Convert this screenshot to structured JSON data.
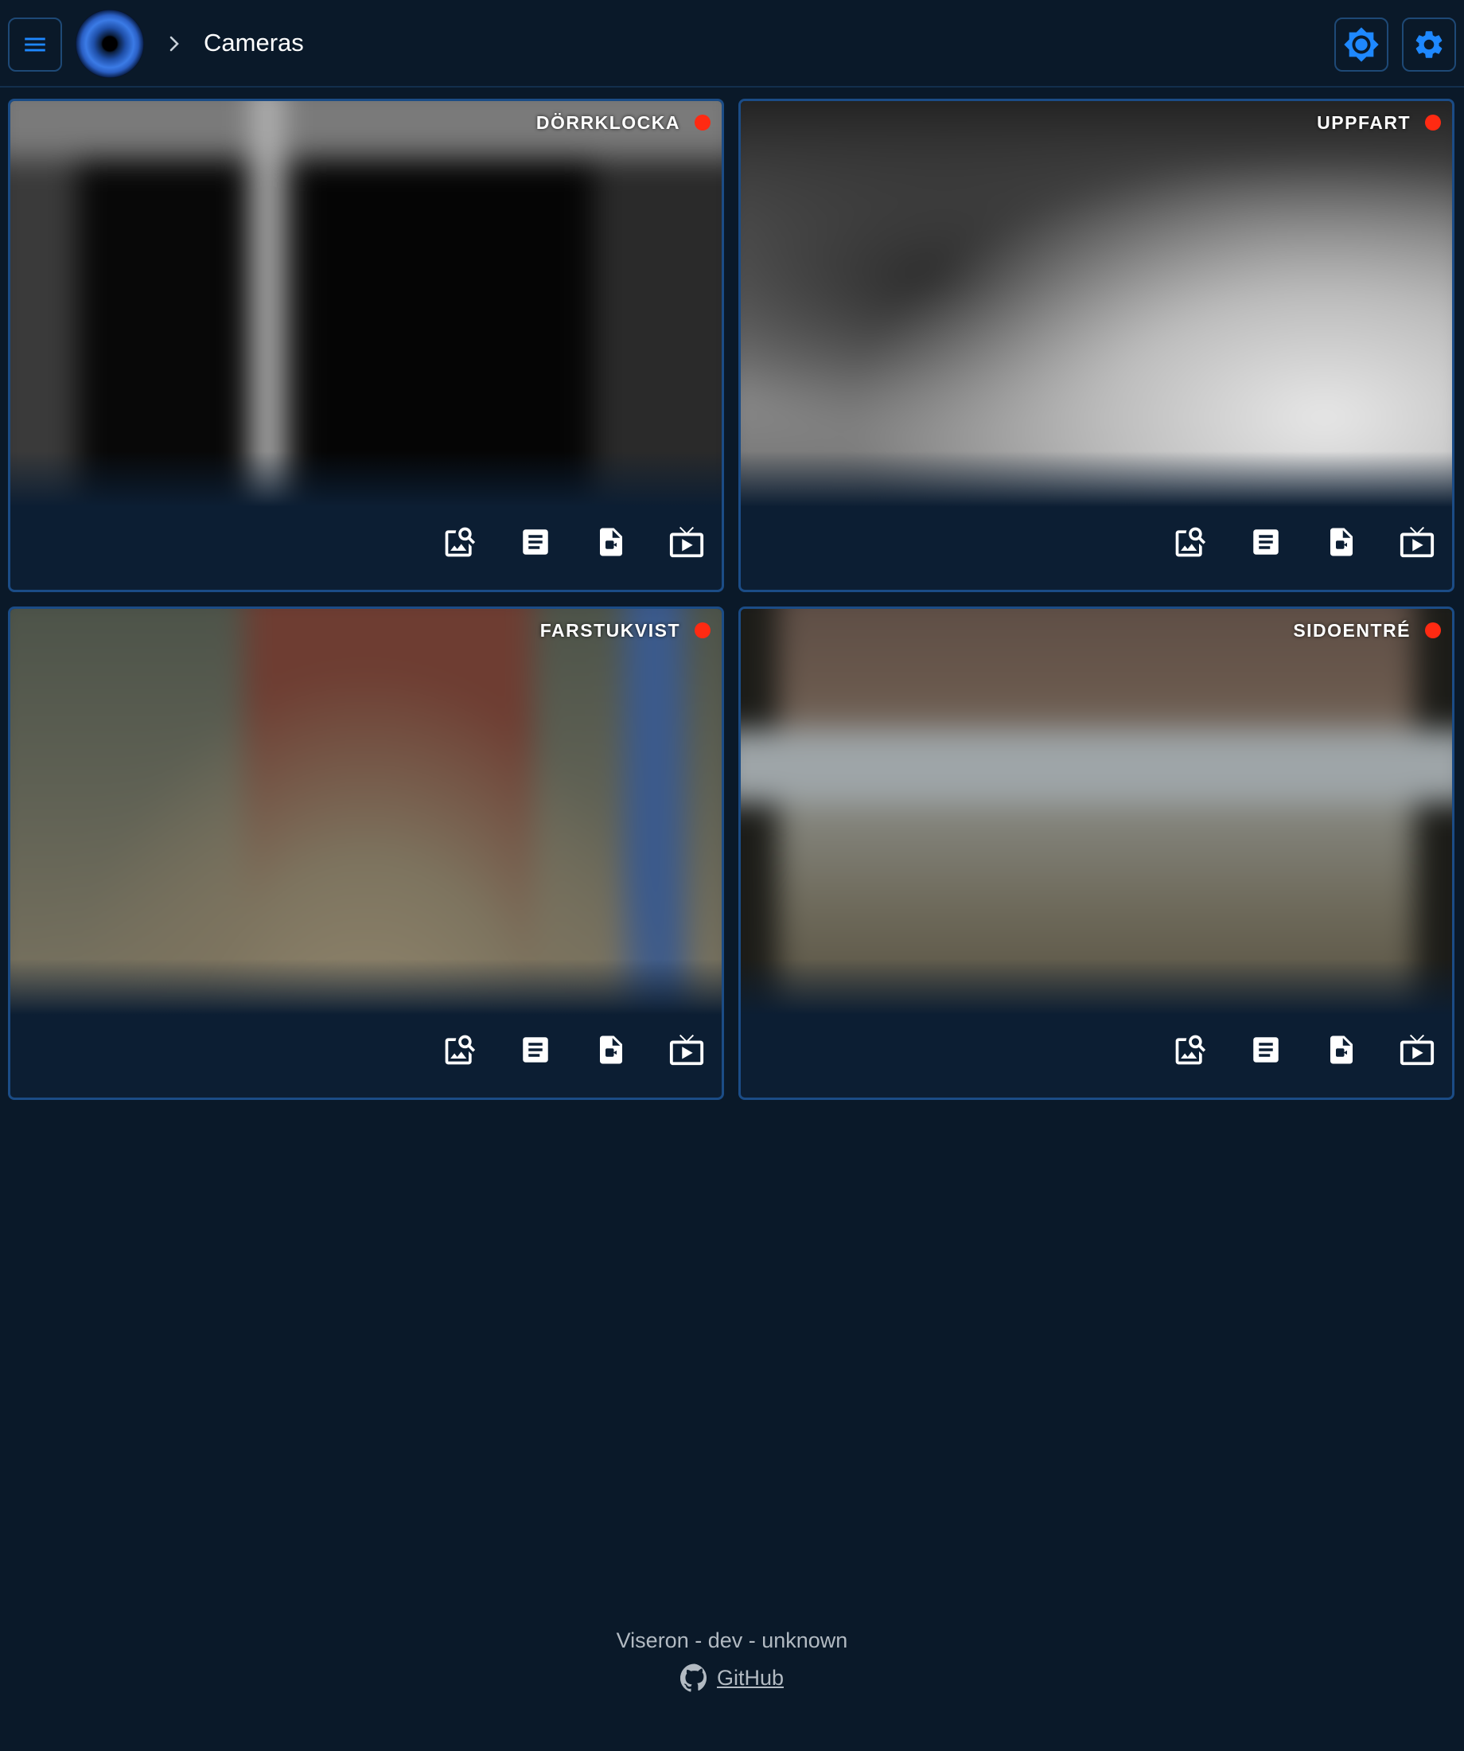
{
  "header": {
    "breadcrumb": "Cameras",
    "icons": {
      "menu": "menu-icon",
      "logo": "eye-logo",
      "separator": "chevron-right-icon",
      "theme": "brightness-icon",
      "settings": "gear-icon"
    },
    "accent_color": "#1e88ff"
  },
  "cameras": [
    {
      "name": "DÖRRKLOCKA",
      "status_color": "#ff2a12"
    },
    {
      "name": "UPPFART",
      "status_color": "#ff2a12"
    },
    {
      "name": "FARSTUKVIST",
      "status_color": "#ff2a12"
    },
    {
      "name": "SIDOENTRÉ",
      "status_color": "#ff2a12"
    }
  ],
  "card_actions": [
    "image-search-icon",
    "events-list-icon",
    "video-file-icon",
    "live-tv-icon"
  ],
  "footer": {
    "version_text": "Viseron - dev - unknown",
    "link_text": "GitHub",
    "link_icon": "github-icon"
  }
}
